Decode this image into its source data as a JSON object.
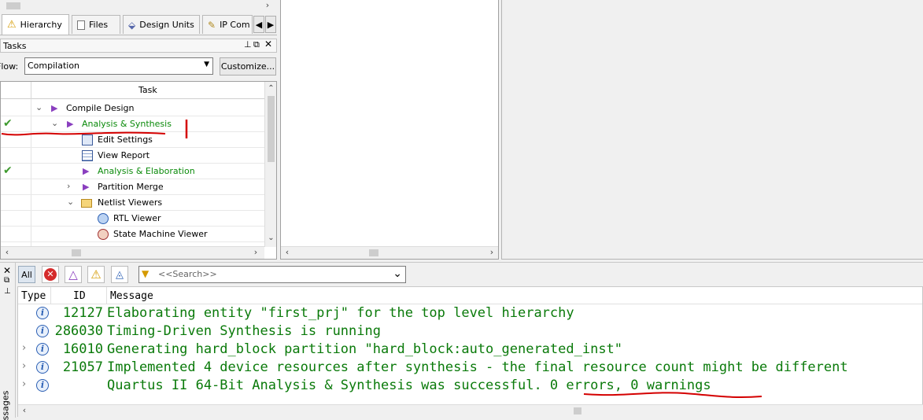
{
  "tabs": [
    {
      "label": "Hierarchy",
      "icon": "hierarchy-warning-icon"
    },
    {
      "label": "Files",
      "icon": "files-icon"
    },
    {
      "label": "Design Units",
      "icon": "design-units-icon"
    },
    {
      "label": "IP Com",
      "icon": "ip-components-icon"
    }
  ],
  "tasks_panel": {
    "title": "Tasks"
  },
  "flow": {
    "label": "Flow:",
    "selected": "Compilation",
    "customize_label": "Customize..."
  },
  "task_table": {
    "header": "Task",
    "rows": [
      {
        "label": "Compile Design",
        "status": "",
        "expand": "collapse",
        "icon": "play-icon"
      },
      {
        "label": "Analysis & Synthesis",
        "status": "done",
        "expand": "collapse",
        "icon": "play-icon"
      },
      {
        "label": "Edit Settings",
        "status": "",
        "expand": "",
        "icon": "settings-window-icon"
      },
      {
        "label": "View Report",
        "status": "",
        "expand": "",
        "icon": "report-table-icon"
      },
      {
        "label": "Analysis & Elaboration",
        "status": "done",
        "expand": "",
        "icon": "play-icon"
      },
      {
        "label": "Partition Merge",
        "status": "",
        "expand": "expand",
        "icon": "play-icon"
      },
      {
        "label": "Netlist Viewers",
        "status": "",
        "expand": "collapse",
        "icon": "folder-icon"
      },
      {
        "label": "RTL Viewer",
        "status": "",
        "expand": "",
        "icon": "rtl-viewer-icon"
      },
      {
        "label": "State Machine Viewer",
        "status": "",
        "expand": "",
        "icon": "state-machine-icon"
      }
    ]
  },
  "messages_toolbar": {
    "all_label": "All",
    "search_placeholder": "<<Search>>"
  },
  "messages": {
    "side_label": "ssages",
    "columns": [
      "Type",
      "ID",
      "Message"
    ],
    "rows": [
      {
        "id": "12127",
        "text": "Elaborating entity \"first_prj\" for the top level hierarchy",
        "expandable": false
      },
      {
        "id": "286030",
        "text": "Timing-Driven Synthesis is running",
        "expandable": false
      },
      {
        "id": "16010",
        "text": "Generating hard_block partition \"hard_block:auto_generated_inst\"",
        "expandable": true
      },
      {
        "id": "21057",
        "text": "Implemented 4 device resources after synthesis - the final resource count might be different",
        "expandable": true
      },
      {
        "id": "",
        "text": "Quartus II 64-Bit Analysis & Synthesis was successful. 0 errors, 0 warnings",
        "expandable": true
      }
    ]
  },
  "colors": {
    "message_text": "#0a7a0a",
    "success_text": "#0a8a0a",
    "annotation": "#d40000"
  }
}
